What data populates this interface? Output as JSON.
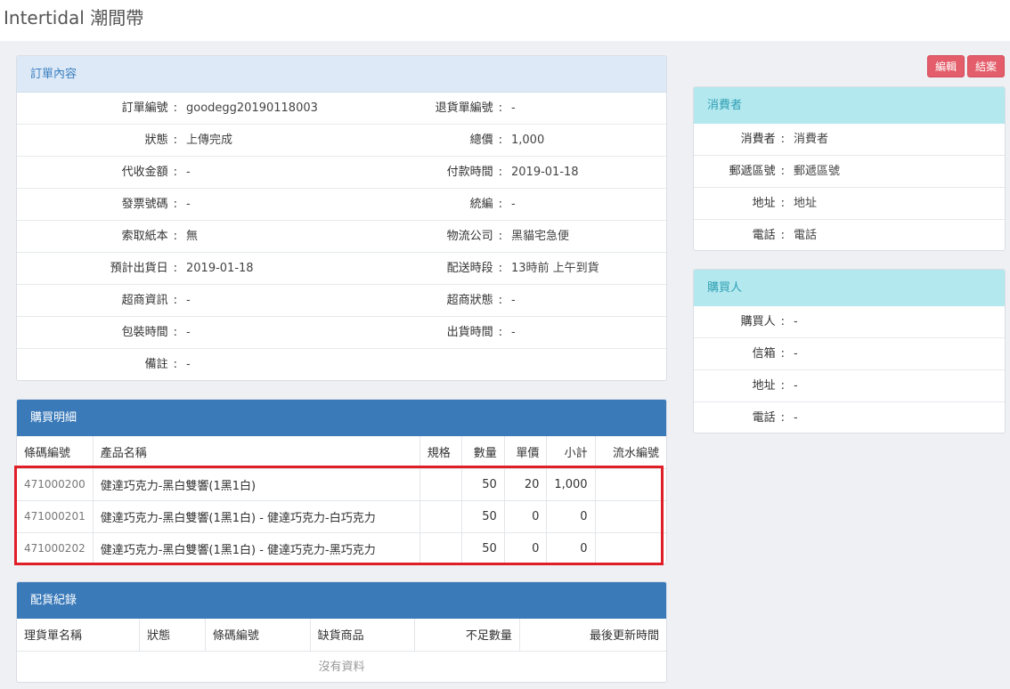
{
  "app_title": "Intertidal 潮間帶",
  "order": {
    "title": "訂單內容",
    "rows": [
      {
        "l1": "訂單編號",
        "v1": "goodegg20190118003",
        "l2": "退貨單編號",
        "v2": "-"
      },
      {
        "l1": "狀態",
        "v1": "上傳完成",
        "l2": "總價",
        "v2": "1,000"
      },
      {
        "l1": "代收金額",
        "v1": "-",
        "l2": "付款時間",
        "v2": "2019-01-18"
      },
      {
        "l1": "發票號碼",
        "v1": "-",
        "l2": "統編",
        "v2": "-"
      },
      {
        "l1": "索取紙本",
        "v1": "無",
        "l2": "物流公司",
        "v2": "黑貓宅急便"
      },
      {
        "l1": "預計出貨日",
        "v1": "2019-01-18",
        "l2": "配送時段",
        "v2": "13時前 上午到貨"
      },
      {
        "l1": "超商資訊",
        "v1": "-",
        "l2": "超商狀態",
        "v2": "-"
      },
      {
        "l1": "包裝時間",
        "v1": "-",
        "l2": "出貨時間",
        "v2": "-"
      },
      {
        "l1": "備註",
        "v1": "-",
        "l2": "",
        "v2": ""
      }
    ]
  },
  "details": {
    "title": "購買明細",
    "headers": [
      "條碼編號",
      "產品名稱",
      "規格",
      "數量",
      "單價",
      "小計",
      "流水編號"
    ],
    "rows": [
      [
        "471000200",
        "健達巧克力-黑白雙響(1黑1白)",
        "",
        "50",
        "20",
        "1,000",
        ""
      ],
      [
        "471000201",
        "健達巧克力-黑白雙響(1黑1白) - 健達巧克力-白巧克力",
        "",
        "50",
        "0",
        "0",
        ""
      ],
      [
        "471000202",
        "健達巧克力-黑白雙響(1黑1白) - 健達巧克力-黑巧克力",
        "",
        "50",
        "0",
        "0",
        ""
      ]
    ]
  },
  "distribution": {
    "title": "配貨紀錄",
    "headers": [
      "理貨單名稱",
      "狀態",
      "條碼編號",
      "缺貨商品",
      "不足數量",
      "最後更新時間"
    ],
    "empty": "沒有資料"
  },
  "buttons": {
    "edit": "編輯",
    "close": "結案"
  },
  "consumer": {
    "title": "消費者",
    "rows": [
      {
        "label": "消費者",
        "value": "消費者"
      },
      {
        "label": "郵遞區號",
        "value": "郵遞區號"
      },
      {
        "label": "地址",
        "value": "地址"
      },
      {
        "label": "電話",
        "value": "電話"
      }
    ]
  },
  "buyer": {
    "title": "購買人",
    "rows": [
      {
        "label": "購買人",
        "value": "-"
      },
      {
        "label": "信箱",
        "value": "-"
      },
      {
        "label": "地址",
        "value": "-"
      },
      {
        "label": "電話",
        "value": "-"
      }
    ]
  },
  "colors": {
    "primary": "#3a7ab9",
    "danger": "#e35d6a",
    "info": "#b3e8ef",
    "highlight": "#e01e27"
  }
}
